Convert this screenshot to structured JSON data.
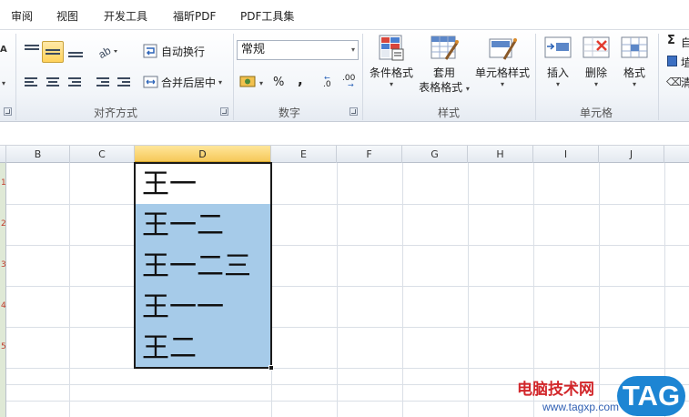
{
  "menu": {
    "tabs": [
      "审阅",
      "视图",
      "开发工具",
      "福昕PDF",
      "PDF工具集"
    ]
  },
  "ribbon": {
    "alignment": {
      "wrap_text": "自动换行",
      "merge_center": "合并后居中",
      "group_label": "对齐方式"
    },
    "number": {
      "format_value": "常规",
      "percent": "%",
      "comma": ",",
      "inc_decimal": ".0",
      "dec_decimal": ".00",
      "group_label": "数字"
    },
    "styles": {
      "conditional": "条件格式",
      "table_line1": "套用",
      "table_line2": "表格格式",
      "cell_styles": "单元格样式",
      "group_label": "样式"
    },
    "cells": {
      "insert": "插入",
      "delete": "删除",
      "format": "格式",
      "group_label": "单元格"
    },
    "editing": {
      "sigma": "Σ",
      "autosum_partial": "自",
      "fill_partial": "埴",
      "clear_partial": "清"
    }
  },
  "sheet": {
    "columns": [
      "B",
      "C",
      "D",
      "E",
      "F",
      "G",
      "H",
      "I",
      "J"
    ],
    "selected_column": "D",
    "cells": [
      "王一",
      "王一二",
      "王一二三",
      "王一一",
      "王二"
    ]
  },
  "watermark": {
    "site_name": "电脑技术网",
    "url": "www.tagxp.com",
    "badge": "TAG"
  }
}
